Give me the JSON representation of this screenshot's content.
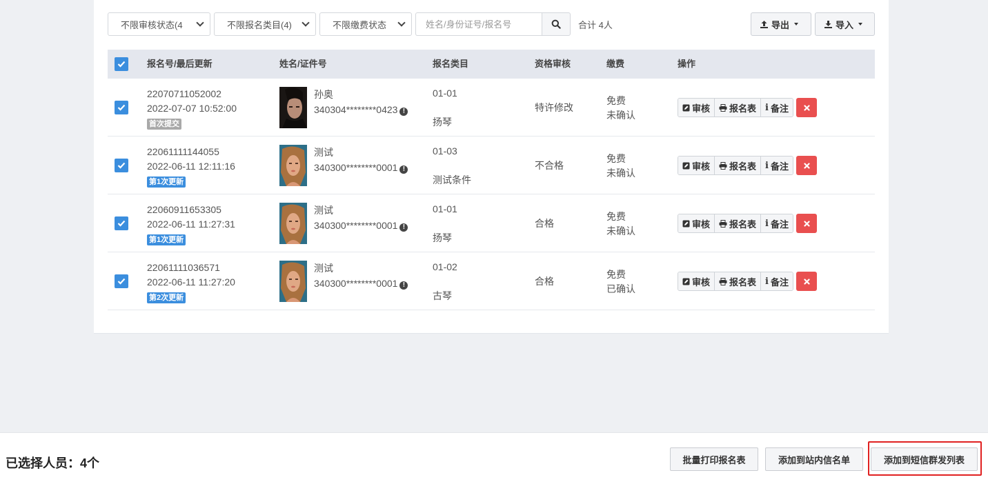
{
  "toolbar": {
    "filters": [
      {
        "label": "不限审核状态(4"
      },
      {
        "label": "不限报名类目(4)"
      },
      {
        "label": "不限缴费状态"
      }
    ],
    "search_placeholder": "姓名/身份证号/报名号",
    "total": "合计 4人",
    "export_label": "导出",
    "import_label": "导入"
  },
  "table": {
    "headers": [
      "报名号/最后更新",
      "姓名/证件号",
      "报名类目",
      "资格审核",
      "缴费",
      "操作"
    ],
    "actions": {
      "review": "审核",
      "form": "报名表",
      "note": "备注"
    },
    "rows": [
      {
        "regno": "22070711052002",
        "updated": "2022-07-07 10:52:00",
        "badge": "首次提交",
        "badge_color": "#a9a9a9",
        "avatar": "dark",
        "name": "孙奥",
        "id": "340304********0423",
        "cat_code": "01-01",
        "cat_name": "扬琴",
        "qual": "特许修改",
        "fee": "免费",
        "fee_status": "未确认",
        "checked": true
      },
      {
        "regno": "22061111144055",
        "updated": "2022-06-11 12:11:16",
        "badge": "第1次更新",
        "badge_color": "#3b8ede",
        "avatar": "warm",
        "name": "测试",
        "id": "340300********0001",
        "cat_code": "01-03",
        "cat_name": "测试条件",
        "qual": "不合格",
        "fee": "免费",
        "fee_status": "未确认",
        "checked": true
      },
      {
        "regno": "22060911653305",
        "updated": "2022-06-11 11:27:31",
        "badge": "第1次更新",
        "badge_color": "#3b8ede",
        "avatar": "warm",
        "name": "测试",
        "id": "340300********0001",
        "cat_code": "01-01",
        "cat_name": "扬琴",
        "qual": "合格",
        "fee": "免费",
        "fee_status": "未确认",
        "checked": true
      },
      {
        "regno": "22061111036571",
        "updated": "2022-06-11 11:27:20",
        "badge": "第2次更新",
        "badge_color": "#3b8ede",
        "avatar": "warm",
        "name": "测试",
        "id": "340300********0001",
        "cat_code": "01-02",
        "cat_name": "古琴",
        "qual": "合格",
        "fee": "免费",
        "fee_status": "已确认",
        "checked": true
      }
    ]
  },
  "footer": {
    "selected_label": "已选择人员：4个",
    "batch_print": "批量打印报名表",
    "add_inbox": "添加到站内信名单",
    "add_sms": "添加到短信群发列表"
  },
  "colors": {
    "accent": "#3b8ede",
    "danger": "#e94f4f",
    "highlight": "#e02020"
  }
}
